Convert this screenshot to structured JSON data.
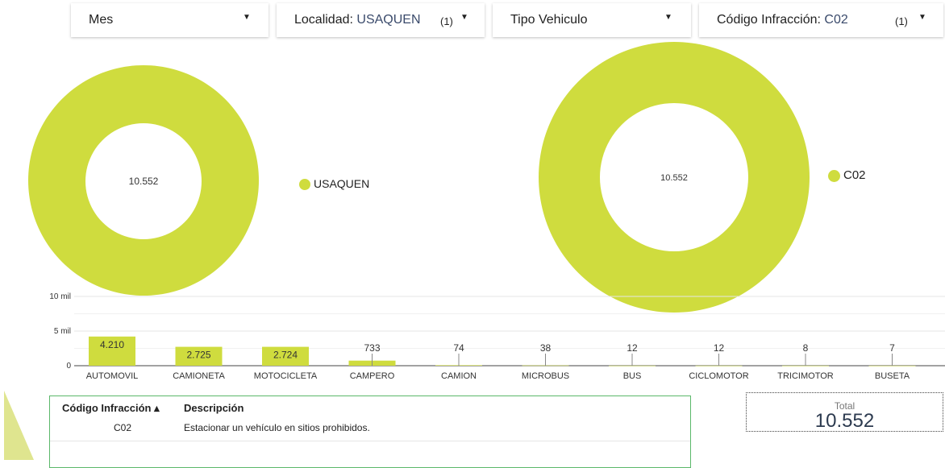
{
  "filters": [
    {
      "label": "Mes",
      "value": "",
      "count": ""
    },
    {
      "label": "Localidad:",
      "value": "USAQUEN",
      "count": "(1)"
    },
    {
      "label": "Tipo Vehiculo",
      "value": "",
      "count": ""
    },
    {
      "label": "Código Infracción:",
      "value": "C02",
      "count": "(1)"
    }
  ],
  "colors": {
    "accent": "#cfdc3e",
    "table_border": "#5bb86a",
    "total_text": "#2c3a4f"
  },
  "chart_data": [
    {
      "type": "pie",
      "variant": "donut",
      "center_label": "10.552",
      "labels": [
        "USAQUEN"
      ],
      "values": [
        10552
      ],
      "legend": "right"
    },
    {
      "type": "pie",
      "variant": "donut",
      "center_label": "10.552",
      "labels": [
        "C02"
      ],
      "values": [
        10552
      ],
      "legend": "right"
    },
    {
      "type": "bar",
      "categories": [
        "AUTOMOVIL",
        "CAMIONETA",
        "MOTOCICLETA",
        "CAMPERO",
        "CAMION",
        "MICROBUS",
        "BUS",
        "CICLOMOTOR",
        "TRICIMOTOR",
        "BUSETA"
      ],
      "values": [
        4210,
        2725,
        2724,
        733,
        74,
        38,
        12,
        12,
        8,
        7
      ],
      "value_labels": [
        "4.210",
        "2.725",
        "2.724",
        "733",
        "74",
        "38",
        "12",
        "12",
        "8",
        "7"
      ],
      "yticks": [
        "0",
        "5 mil",
        "10 mil"
      ],
      "ylim": [
        0,
        10000
      ],
      "grid": true
    }
  ],
  "table": {
    "headers": [
      "Código Infracción ▴",
      "Descripción"
    ],
    "rows": [
      [
        "C02",
        "Estacionar un vehículo en sitios prohibidos."
      ]
    ]
  },
  "total": {
    "label": "Total",
    "value": "10.552"
  }
}
